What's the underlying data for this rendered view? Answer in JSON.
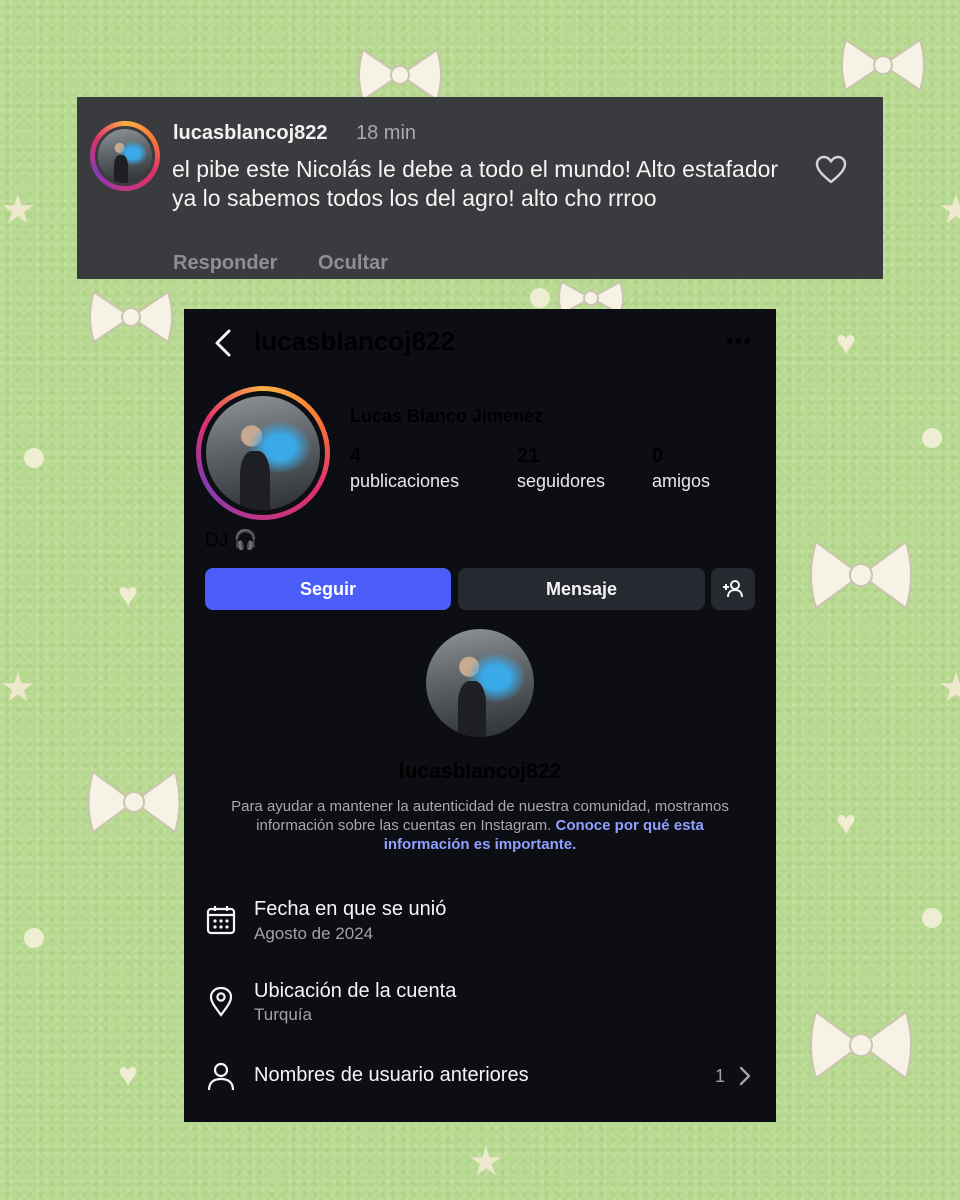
{
  "comment": {
    "username": "lucasblancoj822",
    "time": "18 min",
    "text": "el pibe este Nicolás le debe a todo el mundo! Alto estafador ya lo sabemos todos los del agro! alto cho rrroo",
    "reply_label": "Responder",
    "hide_label": "Ocultar",
    "like_icon": "heart-outline-icon"
  },
  "profile": {
    "handle": "lucasblancoj822",
    "full_name": "Lucas Blanco Jimenez",
    "stats": [
      {
        "value": "4",
        "label": "publicaciones"
      },
      {
        "value": "21",
        "label": "seguidores"
      },
      {
        "value": "0",
        "label": "amigos"
      }
    ],
    "bio": "DJ 🎧",
    "follow_label": "Seguir",
    "message_label": "Mensaje",
    "about": {
      "handle": "lucasblancoj822",
      "notice": "Para ayudar a mantener la autenticidad de nuestra comunidad, mostramos información sobre las cuentas en Instagram.",
      "link": "Conoce por qué esta información es importante."
    },
    "rows": [
      {
        "icon": "calendar-icon",
        "title": "Fecha en que se unió",
        "subtitle": "Agosto de 2024"
      },
      {
        "icon": "location-pin-icon",
        "title": "Ubicación de la cuenta",
        "subtitle": "Turquía"
      },
      {
        "icon": "person-icon",
        "title": "Nombres de usuario anteriores",
        "count": "1"
      }
    ]
  },
  "colors": {
    "background": "#b7d98f",
    "follow_button": "#4a5df9",
    "link": "#8fa0ff",
    "comment_bg": "#3a3b3e",
    "profile_bg": "#0c0e14"
  }
}
